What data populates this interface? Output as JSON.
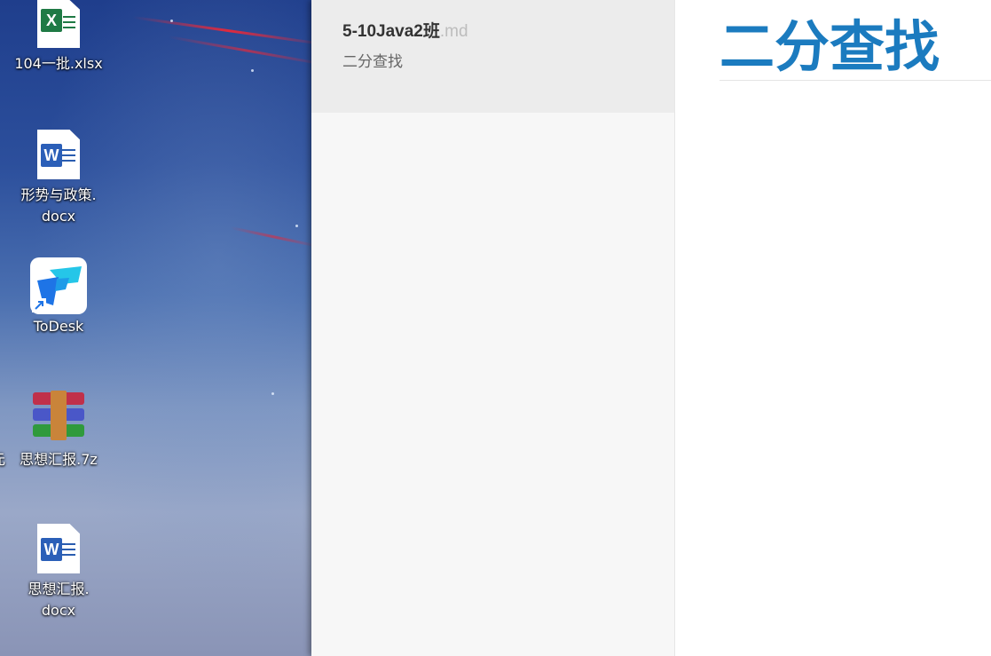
{
  "desktop": {
    "icons": [
      {
        "label": "104一批.xlsx",
        "type": "excel",
        "badge": "X"
      },
      {
        "label": "形势与政策.\ndocx",
        "type": "word",
        "badge": "W"
      },
      {
        "label": "ToDesk",
        "type": "todesk"
      },
      {
        "label": "思想汇报.7z",
        "type": "archive",
        "left_fragment": "元"
      },
      {
        "label": "思想汇报.\ndocx",
        "type": "word",
        "badge": "W"
      }
    ]
  },
  "file_list": {
    "items": [
      {
        "name": "5-10Java2班",
        "ext": ".md",
        "preview": "二分查找"
      }
    ]
  },
  "editor": {
    "heading": "二分查找"
  },
  "colors": {
    "heading": "#1b7bbf",
    "excel_green": "#1f7a45",
    "word_blue": "#2b5fb8",
    "todesk_blue": "#1e9be8"
  }
}
